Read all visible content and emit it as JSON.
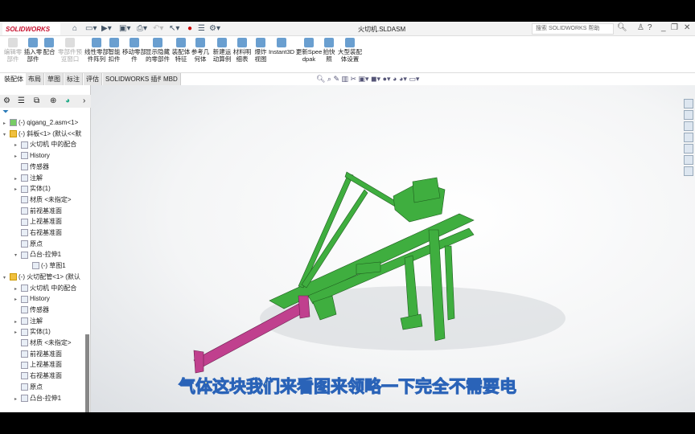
{
  "app": {
    "logo": "SOLIDWORKS",
    "title": "火切机.SLDASM",
    "search_placeholder": "搜索 SOLIDWORKS 帮助"
  },
  "ribbon": [
    {
      "label": "编辑零部件",
      "enabled": false
    },
    {
      "label": "插入零部件",
      "enabled": true
    },
    {
      "label": "配合",
      "enabled": true
    },
    {
      "label": "零部件预览窗口",
      "enabled": false
    },
    {
      "label": "线性零部件阵列",
      "enabled": true
    },
    {
      "label": "智能扣件",
      "enabled": true
    },
    {
      "label": "移动零部件",
      "enabled": true
    },
    {
      "label": "显示隐藏的零部件",
      "enabled": true
    },
    {
      "label": "装配体特征",
      "enabled": true
    },
    {
      "label": "参考几何体",
      "enabled": true
    },
    {
      "label": "新建运动算例",
      "enabled": true
    },
    {
      "label": "材料明细表",
      "enabled": true
    },
    {
      "label": "爆炸视图",
      "enabled": true
    },
    {
      "label": "Instant3D",
      "enabled": true
    },
    {
      "label": "更新Speedpak",
      "enabled": true
    },
    {
      "label": "拍快照",
      "enabled": true
    },
    {
      "label": "大型装配体设置",
      "enabled": true
    }
  ],
  "tabs": [
    "装配体",
    "布局",
    "草图",
    "标注",
    "评估",
    "SOLIDWORKS 插件",
    "MBD"
  ],
  "tree": [
    {
      "label": "(-) qigang_2.asm<1>",
      "level": 0,
      "arrow": "▸",
      "icon": "assembly-icon"
    },
    {
      "label": "(-) 斜板<1> (默认<<默",
      "level": 0,
      "arrow": "▾",
      "icon": "part-icon"
    },
    {
      "label": "火切机 中的配合",
      "level": 1,
      "arrow": "▸",
      "icon": "mates-icon"
    },
    {
      "label": "History",
      "level": 1,
      "arrow": "▸",
      "icon": "history-icon"
    },
    {
      "label": "传感器",
      "level": 1,
      "arrow": "",
      "icon": "sensor-icon"
    },
    {
      "label": "注解",
      "level": 1,
      "arrow": "▸",
      "icon": "annotation-icon"
    },
    {
      "label": "实体(1)",
      "level": 1,
      "arrow": "▸",
      "icon": "solid-bodies-icon"
    },
    {
      "label": "材质 <未指定>",
      "level": 1,
      "arrow": "",
      "icon": "material-icon"
    },
    {
      "label": "前视基准面",
      "level": 1,
      "arrow": "",
      "icon": "plane-icon"
    },
    {
      "label": "上视基准面",
      "level": 1,
      "arrow": "",
      "icon": "plane-icon"
    },
    {
      "label": "右视基准面",
      "level": 1,
      "arrow": "",
      "icon": "plane-icon"
    },
    {
      "label": "原点",
      "level": 1,
      "arrow": "",
      "icon": "origin-icon"
    },
    {
      "label": "凸台-拉伸1",
      "level": 1,
      "arrow": "▾",
      "icon": "extrude-icon"
    },
    {
      "label": "(-) 草图1",
      "level": 2,
      "arrow": "",
      "icon": "sketch-icon"
    },
    {
      "label": "(-) 火切配管<1> (默认",
      "level": 0,
      "arrow": "▾",
      "icon": "part-icon"
    },
    {
      "label": "火切机 中的配合",
      "level": 1,
      "arrow": "▸",
      "icon": "mates-icon"
    },
    {
      "label": "History",
      "level": 1,
      "arrow": "▸",
      "icon": "history-icon"
    },
    {
      "label": "传感器",
      "level": 1,
      "arrow": "",
      "icon": "sensor-icon"
    },
    {
      "label": "注解",
      "level": 1,
      "arrow": "▸",
      "icon": "annotation-icon"
    },
    {
      "label": "实体(1)",
      "level": 1,
      "arrow": "▸",
      "icon": "solid-bodies-icon"
    },
    {
      "label": "材质 <未指定>",
      "level": 1,
      "arrow": "",
      "icon": "material-icon"
    },
    {
      "label": "前视基准面",
      "level": 1,
      "arrow": "",
      "icon": "plane-icon"
    },
    {
      "label": "上视基准面",
      "level": 1,
      "arrow": "",
      "icon": "plane-icon"
    },
    {
      "label": "右视基准面",
      "level": 1,
      "arrow": "",
      "icon": "plane-icon"
    },
    {
      "label": "原点",
      "level": 1,
      "arrow": "",
      "icon": "origin-icon"
    },
    {
      "label": "凸台-拉伸1",
      "level": 1,
      "arrow": "▸",
      "icon": "extrude-icon"
    }
  ],
  "colors": {
    "model_green": "#3fae3f",
    "model_pink": "#c0408e",
    "subtitle": "#fff59a"
  },
  "subtitle": "气体这块我们来看图来领略一下完全不需要电"
}
